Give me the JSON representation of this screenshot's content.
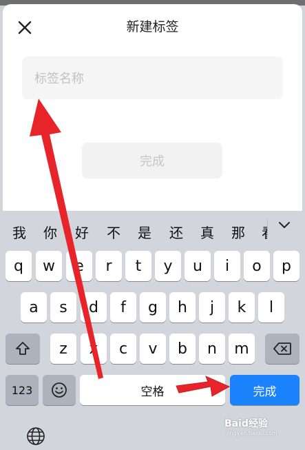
{
  "dialog": {
    "title": "新建标签",
    "input_placeholder": "标签名称",
    "done_label": "完成"
  },
  "keyboard": {
    "candidates": [
      "我",
      "你",
      "好",
      "不",
      "是",
      "还",
      "真",
      "那",
      "看"
    ],
    "row1": [
      "q",
      "w",
      "e",
      "r",
      "t",
      "y",
      "u",
      "i",
      "o",
      "p"
    ],
    "row2": [
      "a",
      "s",
      "d",
      "f",
      "g",
      "h",
      "j",
      "k",
      "l"
    ],
    "row3": [
      "z",
      "x",
      "c",
      "v",
      "b",
      "n",
      "m"
    ],
    "numbers_label": "123",
    "space_label": "空格",
    "done_label": "完成"
  },
  "watermark": {
    "brand": "Baid经验",
    "url": "jingyan.baidu.com"
  }
}
